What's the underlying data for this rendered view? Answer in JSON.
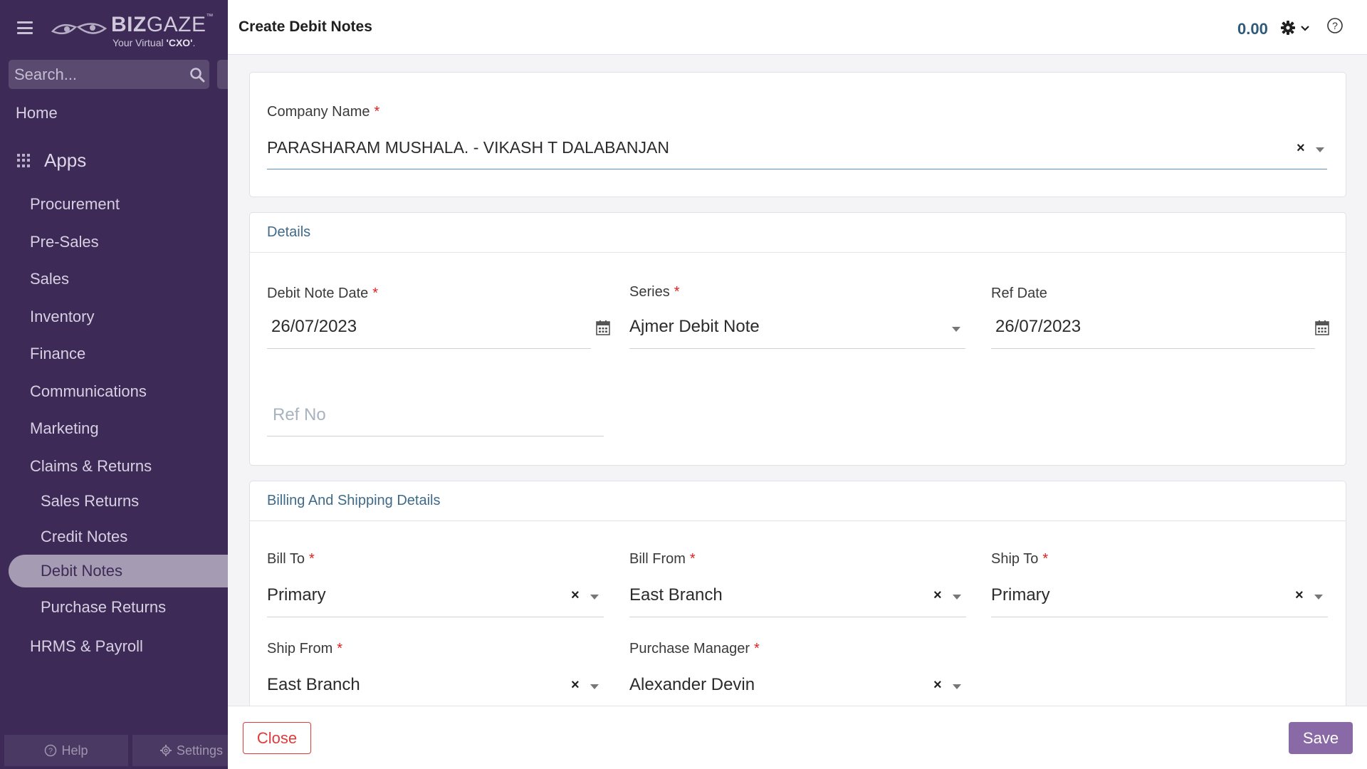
{
  "brand": {
    "name_bold": "BIZ",
    "name_light": "GAZE",
    "tm": "™",
    "tagline_prefix": "Your Virtual ",
    "tagline_bold": "'CXO'",
    "tagline_suffix": "."
  },
  "search": {
    "placeholder": "Search..."
  },
  "sidebar": {
    "home": "Home",
    "apps_label": "Apps",
    "apps": [
      "Procurement",
      "Pre-Sales",
      "Sales",
      "Inventory",
      "Finance",
      "Communications",
      "Marketing",
      "Claims & Returns"
    ],
    "claims_sub": [
      "Sales Returns",
      "Credit Notes",
      "Debit Notes",
      "Purchase Returns"
    ],
    "active_item": "Debit Notes",
    "after": "HRMS & Payroll",
    "help_label": "Help",
    "settings_label": "Settings"
  },
  "header": {
    "title": "Create Debit Notes",
    "amount": "0.00"
  },
  "company": {
    "label": "Company Name",
    "value": "PARASHARAM MUSHALA. - VIKASH T DALABANJAN"
  },
  "details": {
    "title": "Details",
    "debit_note_date_label": "Debit Note Date",
    "debit_note_date": "26/07/2023",
    "series_label": "Series",
    "series": "Ajmer Debit Note",
    "ref_date_label": "Ref Date",
    "ref_date": "26/07/2023",
    "ref_no_placeholder": "Ref No"
  },
  "billing": {
    "title": "Billing And Shipping Details",
    "bill_to_label": "Bill To",
    "bill_to": "Primary",
    "bill_from_label": "Bill From",
    "bill_from": "East Branch",
    "ship_to_label": "Ship To",
    "ship_to": "Primary",
    "ship_from_label": "Ship From",
    "ship_from": "East Branch",
    "purchase_manager_label": "Purchase Manager",
    "purchase_manager": "Alexander Devin"
  },
  "footer": {
    "close_label": "Close",
    "save_label": "Save"
  },
  "colors": {
    "sidebar_bg": "#3d2a57",
    "accent": "#8a6aa6",
    "link_blue": "#3f6a8a",
    "required": "#e02020",
    "close_red": "#e03a3a"
  }
}
